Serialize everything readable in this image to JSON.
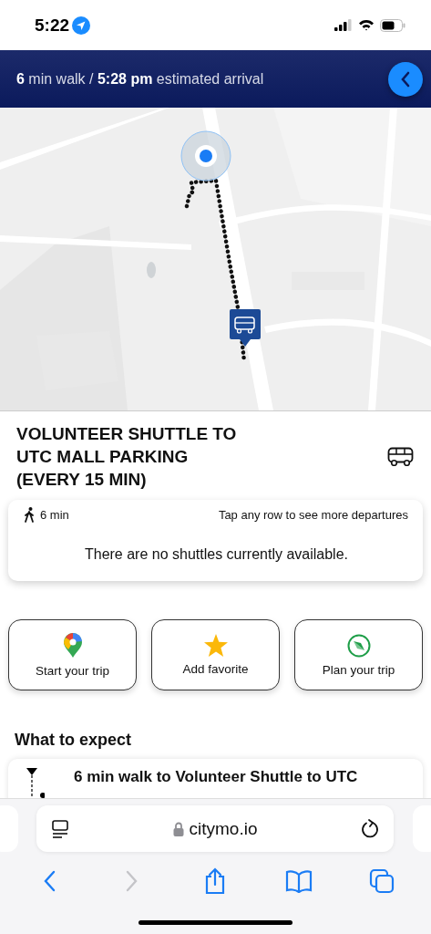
{
  "status_bar": {
    "time": "5:22"
  },
  "header": {
    "summary": "**6** min walk / **5:28 pm** estimated arrival"
  },
  "route": {
    "title": "VOLUNTEER SHUTTLE TO UTC MALL PARKING (EVERY 15 MIN)"
  },
  "departures": {
    "walk_time": "6 min",
    "hint": "Tap any row to see more departures",
    "message": "There are no shuttles currently available."
  },
  "actions": [
    {
      "kind": "map-pin",
      "label": "Start your trip"
    },
    {
      "kind": "star",
      "label": "Add favorite"
    },
    {
      "kind": "compass",
      "label": "Plan your trip"
    }
  ],
  "expect": {
    "heading": "What to expect",
    "steps": [
      {
        "kind": "walk",
        "text": "6 min walk to Volunteer Shuttle to UTC"
      }
    ]
  },
  "browser": {
    "address": "citymo.io",
    "nav": [
      {
        "kind": "back",
        "disabled": false
      },
      {
        "kind": "forward",
        "disabled": true
      },
      {
        "kind": "share",
        "disabled": false
      },
      {
        "kind": "bookmarks",
        "disabled": false
      },
      {
        "kind": "tabs",
        "disabled": false
      }
    ]
  }
}
